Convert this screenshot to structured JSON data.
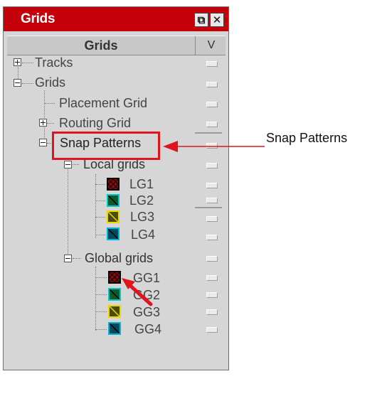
{
  "panel": {
    "title": "Grids",
    "restore_icon": "restore-window-icon",
    "close_icon": "close-icon"
  },
  "header": {
    "name_col": "Grids",
    "v_col": "V"
  },
  "tree": {
    "tracks": "Tracks",
    "grids": "Grids",
    "placement_grid": "Placement Grid",
    "routing_grid": "Routing Grid",
    "snap_patterns": "Snap Patterns",
    "local_grids": "Local grids",
    "lg1": "LG1",
    "lg2": "LG2",
    "lg3": "LG3",
    "lg4": "LG4",
    "global_grids": "Global grids",
    "gg1": "GG1",
    "gg2": "GG2",
    "gg3": "GG3",
    "gg4": "GG4"
  },
  "swatch_colors": {
    "red": "#8e0a0c",
    "green": "#0c5a2a",
    "yellow": "#d4c200",
    "cyan": "#00a8c8"
  },
  "annotation": {
    "callout": "Snap Patterns",
    "highlight_color": "#e0141e"
  }
}
